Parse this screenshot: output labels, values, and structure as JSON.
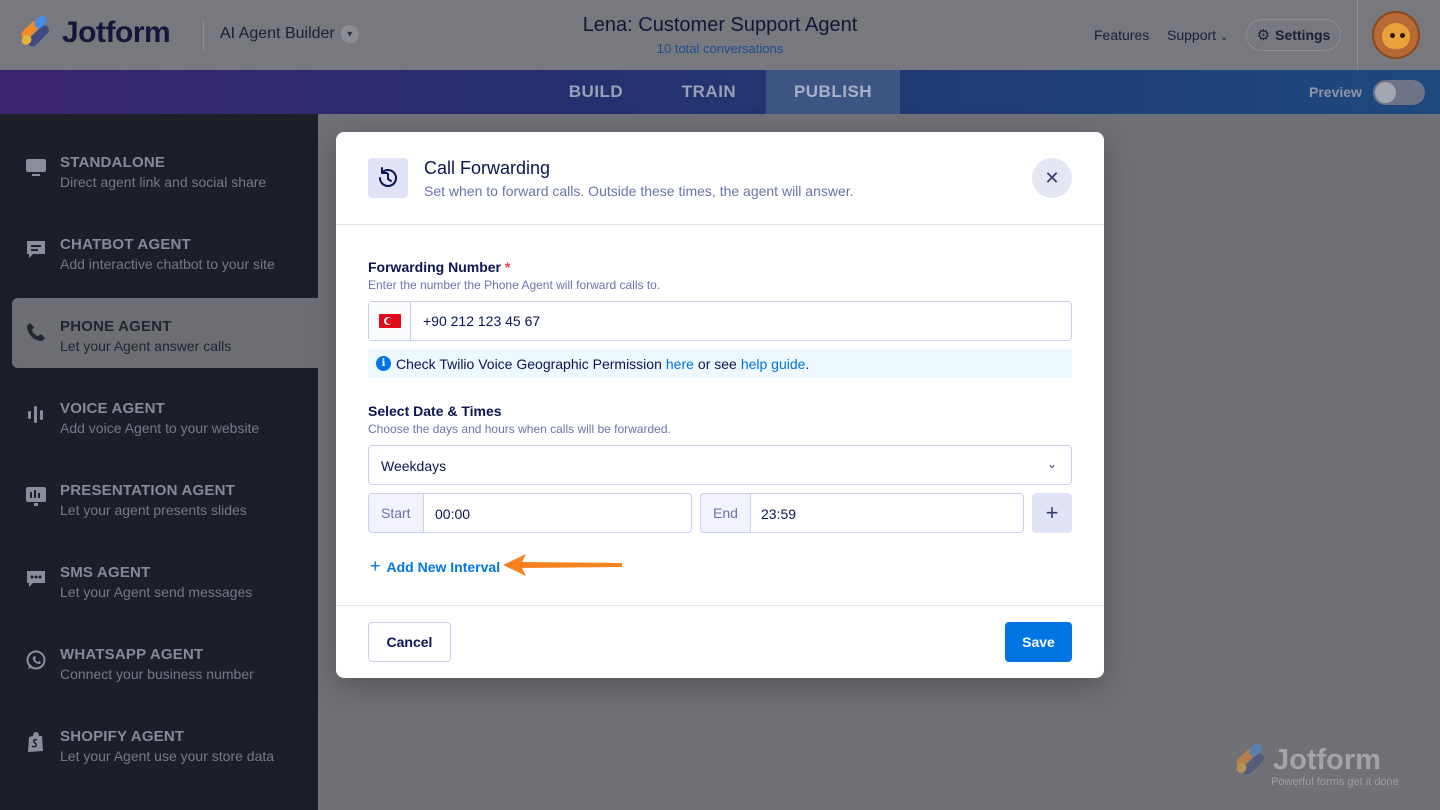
{
  "header": {
    "logo_text": "Jotform",
    "builder_label": "AI Agent Builder",
    "agent_title": "Lena: Customer Support Agent",
    "conversations": "10 total conversations",
    "nav": {
      "features": "Features",
      "support": "Support",
      "settings": "Settings"
    }
  },
  "tabs": [
    {
      "label": "BUILD"
    },
    {
      "label": "TRAIN"
    },
    {
      "label": "PUBLISH",
      "active": true
    }
  ],
  "preview_label": "Preview",
  "sidebar": {
    "items": [
      {
        "title": "STANDALONE",
        "desc": "Direct agent link and social share",
        "icon": "monitor-icon"
      },
      {
        "title": "CHATBOT AGENT",
        "desc": "Add interactive chatbot to your site",
        "icon": "chat-icon"
      },
      {
        "title": "PHONE AGENT",
        "desc": "Let your Agent answer calls",
        "icon": "phone-icon",
        "active": true
      },
      {
        "title": "VOICE AGENT",
        "desc": "Add voice Agent to your website",
        "icon": "soundwave-icon"
      },
      {
        "title": "PRESENTATION AGENT",
        "desc": "Let your agent presents slides",
        "icon": "presentation-icon"
      },
      {
        "title": "SMS AGENT",
        "desc": "Let your Agent send messages",
        "icon": "sms-icon"
      },
      {
        "title": "WHATSAPP AGENT",
        "desc": "Connect your business number",
        "icon": "whatsapp-icon"
      },
      {
        "title": "SHOPIFY AGENT",
        "desc": "Let your Agent use your store data",
        "icon": "shopify-icon"
      }
    ]
  },
  "watermark": {
    "text": "Jotform",
    "tagline": "Powerful forms get it done"
  },
  "modal": {
    "title": "Call Forwarding",
    "subtitle": "Set when to forward calls. Outside these times, the agent will answer.",
    "forwarding": {
      "label": "Forwarding Number",
      "required_mark": "*",
      "help": "Enter the number the Phone Agent will forward calls to.",
      "country": "Turkey",
      "value": "+90 212 123 45 67"
    },
    "info": {
      "text_before": "Check Twilio Voice Geographic Permission",
      "link1": "here",
      "text_mid": "or see",
      "link2": "help guide",
      "text_after": "."
    },
    "schedule": {
      "label": "Select Date & Times",
      "help": "Choose the days and hours when calls will be forwarded.",
      "days": "Weekdays",
      "start_label": "Start",
      "start_value": "00:00",
      "end_label": "End",
      "end_value": "23:59",
      "add_interval": "Add New Interval"
    },
    "cancel_label": "Cancel",
    "save_label": "Save"
  },
  "colors": {
    "accent": "#0075e3",
    "navy": "#0a1551",
    "annotation_arrow": "#f5821f"
  }
}
